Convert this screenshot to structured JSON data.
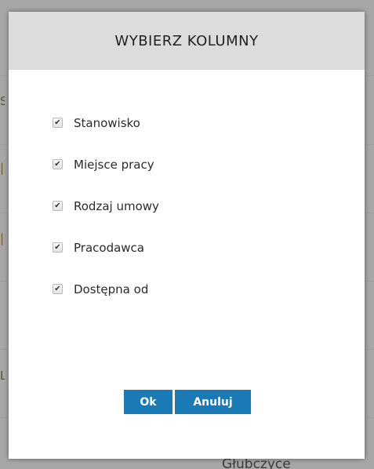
{
  "background": {
    "visible_text": "Głubczyce"
  },
  "dialog": {
    "title": "WYBIERZ KOLUMNY",
    "options": [
      {
        "label": "Stanowisko",
        "checked": true
      },
      {
        "label": "Miejsce pracy",
        "checked": true
      },
      {
        "label": "Rodzaj umowy",
        "checked": true
      },
      {
        "label": "Pracodawca",
        "checked": true
      },
      {
        "label": "Dostępna od",
        "checked": true
      }
    ],
    "ok_label": "Ok",
    "cancel_label": "Anuluj"
  },
  "colors": {
    "button": "#1a7ab5",
    "header": "#dcdcdc",
    "overlay": "#a7a7a7"
  }
}
